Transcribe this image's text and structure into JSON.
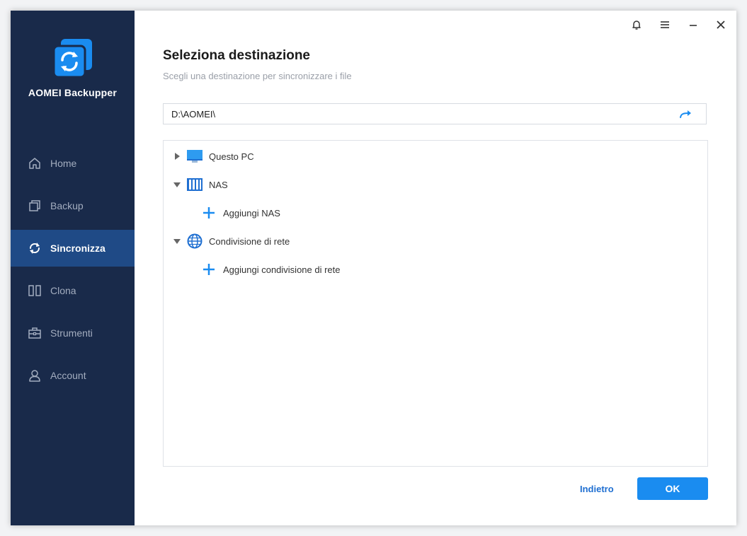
{
  "app": {
    "name": "AOMEI Backupper"
  },
  "sidebar": {
    "items": [
      {
        "label": "Home",
        "icon": "home-icon",
        "active": false
      },
      {
        "label": "Backup",
        "icon": "backup-icon",
        "active": false
      },
      {
        "label": "Sincronizza",
        "icon": "sync-icon",
        "active": true
      },
      {
        "label": "Clona",
        "icon": "clone-icon",
        "active": false
      },
      {
        "label": "Strumenti",
        "icon": "tools-icon",
        "active": false
      },
      {
        "label": "Account",
        "icon": "account-icon",
        "active": false
      }
    ]
  },
  "titlebar": {
    "icons": [
      "bell-icon",
      "menu-icon",
      "minimize-icon",
      "close-icon"
    ]
  },
  "page": {
    "title": "Seleziona destinazione",
    "subtitle": "Scegli una destinazione per sincronizzare i file"
  },
  "path": {
    "value": "D:\\AOMEI\\"
  },
  "tree": {
    "nodes": [
      {
        "label": "Questo PC",
        "icon": "computer-icon",
        "expanded": false
      },
      {
        "label": "NAS",
        "icon": "nas-icon",
        "expanded": true
      },
      {
        "label": "Aggiungi NAS",
        "icon": "plus-icon"
      },
      {
        "label": "Condivisione di rete",
        "icon": "globe-icon",
        "expanded": true
      },
      {
        "label": "Aggiungi condivisione di rete",
        "icon": "plus-icon"
      }
    ]
  },
  "footer": {
    "back_label": "Indietro",
    "ok_label": "OK"
  },
  "colors": {
    "sidebar_bg": "#192a4a",
    "sidebar_active": "#1f4a86",
    "accent": "#1a8cf0",
    "link": "#1f6fd1"
  }
}
